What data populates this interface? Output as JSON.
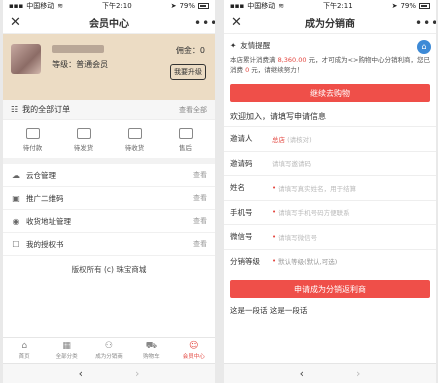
{
  "colors": {
    "accent": "#ef4f49",
    "profile_bg": "#ecdcc4",
    "link_blue": "#3d8ad6"
  },
  "left": {
    "status": {
      "carrier": "中国移动",
      "time": "下午2:10",
      "battery": "79%"
    },
    "title": "会员中心",
    "profile": {
      "level": "等级：普通会员",
      "commission": "佣金：0",
      "upgrade": "我要升级"
    },
    "orders": {
      "label": "我的全部订单",
      "view_all": "查看全部"
    },
    "order_types": [
      {
        "label": "待付款",
        "icon": "wallet-icon"
      },
      {
        "label": "待发货",
        "icon": "box-icon"
      },
      {
        "label": "待收货",
        "icon": "truck-icon"
      },
      {
        "label": "售后",
        "icon": "service-icon"
      }
    ],
    "menu": [
      {
        "label": "云仓管理",
        "action": "查看",
        "icon": "cloud-icon"
      },
      {
        "label": "推广二维码",
        "action": "查看",
        "icon": "qrcode-icon"
      },
      {
        "label": "收货地址管理",
        "action": "查看",
        "icon": "location-icon"
      },
      {
        "label": "我的授权书",
        "action": "查看",
        "icon": "certificate-icon"
      }
    ],
    "copyright": "版权所有 (c) 珠宝商城",
    "tabs": [
      {
        "label": "首页",
        "icon": "home-icon"
      },
      {
        "label": "全部分类",
        "icon": "grid-icon"
      },
      {
        "label": "成为分销商",
        "icon": "users-icon"
      },
      {
        "label": "购物车",
        "icon": "cart-icon"
      },
      {
        "label": "会员中心",
        "icon": "user-icon"
      }
    ]
  },
  "right": {
    "status": {
      "carrier": "中国移动",
      "time": "下午2:11",
      "battery": "79%"
    },
    "title": "成为分销商",
    "notice_title": "友情提醒",
    "notice_1": "本店累计消费满",
    "notice_amount": "8,360.00",
    "notice_2": "元，才可成为<>购物中心分销利商，您已消费",
    "notice_spent": "0",
    "notice_3": "元，请继续努力！",
    "shop_button": "继续去购物",
    "welcome": "欢迎加入，请填写申请信息",
    "form": {
      "referrer_label": "邀请人",
      "referrer_value": "总店",
      "referrer_suffix": "(请核对)",
      "invite_label": "邀请码",
      "invite_placeholder": "请填写邀请码",
      "name_label": "姓名",
      "name_placeholder": "请填写真实姓名，用于结算",
      "phone_label": "手机号",
      "phone_placeholder": "请填写手机号码方便联系",
      "wechat_label": "微信号",
      "wechat_placeholder": "请填写微信号",
      "level_label": "分销等级",
      "level_value": "默认等级(默认,可选)"
    },
    "apply_button": "申请成为分销返利商",
    "hint": "这是一段话  这是一段话"
  },
  "nav": {
    "back": "‹",
    "forward": "›"
  }
}
